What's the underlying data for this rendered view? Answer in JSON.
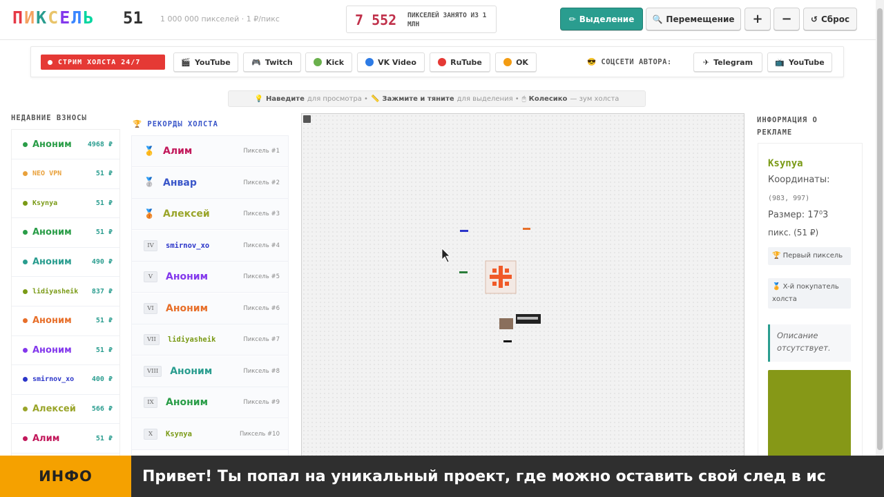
{
  "header": {
    "logo_letters": [
      "П",
      "И",
      "К",
      "С",
      "Е",
      "Л",
      "Ь"
    ],
    "logo_colors": [
      "#e63946",
      "#f4a261",
      "#2a9d8f",
      "#e9c46a",
      "#8338ec",
      "#3a86ff",
      "#06d6a0"
    ],
    "logo_number": "51",
    "subtitle": "1 000 000 пикселей · 1 ₽/пикс",
    "counter_value": "7 552",
    "counter_label": "ПИКСЕЛЕЙ ЗАНЯТО ИЗ 1 МЛН",
    "tools": {
      "select_label": "Выделение",
      "move_label": "Перемещение",
      "zoom_in": "+",
      "zoom_out": "−",
      "reset_label": "Сброс"
    }
  },
  "streams": {
    "live_label": "СТРИМ ХОЛСТА 24/7",
    "buttons": [
      {
        "label": "YouTube",
        "icon": "🎬"
      },
      {
        "label": "Twitch",
        "icon": "🎮"
      },
      {
        "label": "Kick",
        "color": "#6ab04c"
      },
      {
        "label": "VK Video",
        "color": "#2d7be5"
      },
      {
        "label": "RuTube",
        "color": "#e53935"
      },
      {
        "label": "OK",
        "color": "#f39c12"
      }
    ],
    "author_label": "СОЦСЕТИ АВТОРА:",
    "author_buttons": [
      {
        "label": "Telegram",
        "icon": "✈"
      },
      {
        "label": "YouTube",
        "icon": "📺"
      }
    ]
  },
  "hint": {
    "part1_bold": "Наведите",
    "part1": "для просмотра •",
    "part2_bold": "Зажмите и тяните",
    "part2": "для выделения •",
    "part3_bold": "Колесико",
    "part3": "— зум холста"
  },
  "recent": {
    "title": "НЕДАВНИЕ ВЗНОСЫ",
    "items": [
      {
        "name": "Аноним",
        "amount": "4968 ₽",
        "color": "#2a9d48",
        "small": false
      },
      {
        "name": "NEO VPN",
        "amount": "51 ₽",
        "color": "#e9a13b",
        "small": true
      },
      {
        "name": "Ksynya",
        "amount": "51 ₽",
        "color": "#7a9a16",
        "small": true
      },
      {
        "name": "Аноним",
        "amount": "51 ₽",
        "color": "#2a9d48",
        "small": false
      },
      {
        "name": "Аноним",
        "amount": "490 ₽",
        "color": "#2a9d8f",
        "small": false
      },
      {
        "name": "lidiyasheik",
        "amount": "837 ₽",
        "color": "#7a9a16",
        "small": true
      },
      {
        "name": "Аноним",
        "amount": "51 ₽",
        "color": "#e76f2a",
        "small": false
      },
      {
        "name": "Аноним",
        "amount": "51 ₽",
        "color": "#8338ec",
        "small": false
      },
      {
        "name": "smirnov_xo",
        "amount": "400 ₽",
        "color": "#2b35c9",
        "small": true
      },
      {
        "name": "Алексей",
        "amount": "566 ₽",
        "color": "#9aa52a",
        "small": false
      },
      {
        "name": "Алим",
        "amount": "51 ₽",
        "color": "#c2185b",
        "small": false
      }
    ]
  },
  "records": {
    "title": "РЕКОРДЫ ХОЛСТА",
    "items": [
      {
        "rank": "🥇",
        "name": "Алим",
        "pixel": "Пиксель #1",
        "color": "#c2185b",
        "mono": false,
        "medal": true
      },
      {
        "rank": "🥈",
        "name": "Анвар",
        "pixel": "Пиксель #2",
        "color": "#3a56c9",
        "mono": false,
        "medal": true
      },
      {
        "rank": "🥉",
        "name": "Алексей",
        "pixel": "Пиксель #3",
        "color": "#9aa52a",
        "mono": false,
        "medal": true
      },
      {
        "rank": "IV",
        "name": "smirnov_xo",
        "pixel": "Пиксель #4",
        "color": "#2b35c9",
        "mono": true,
        "medal": false
      },
      {
        "rank": "V",
        "name": "Аноним",
        "pixel": "Пиксель #5",
        "color": "#8338ec",
        "mono": false,
        "medal": false
      },
      {
        "rank": "VI",
        "name": "Аноним",
        "pixel": "Пиксель #6",
        "color": "#e76f2a",
        "mono": false,
        "medal": false
      },
      {
        "rank": "VII",
        "name": "lidiyasheik",
        "pixel": "Пиксель #7",
        "color": "#7a9a16",
        "mono": true,
        "medal": false
      },
      {
        "rank": "VIII",
        "name": "Аноним",
        "pixel": "Пиксель #8",
        "color": "#2a9d8f",
        "mono": false,
        "medal": false
      },
      {
        "rank": "IX",
        "name": "Аноним",
        "pixel": "Пиксель #9",
        "color": "#2a9d48",
        "mono": false,
        "medal": false
      },
      {
        "rank": "X",
        "name": "Ksynya",
        "pixel": "Пиксель #10",
        "color": "#7a9a16",
        "mono": true,
        "medal": false
      }
    ]
  },
  "ad": {
    "title": "ИНФОРМАЦИЯ О РЕКЛАМЕ",
    "name": "Ksynya",
    "coords_label": "Координаты:",
    "coords_value": "(983, 997)",
    "size_label": "Размер: 17⁰3",
    "size_value": "пикс. (51 ₽)",
    "badge1": "🏆 Первый пиксель",
    "badge2": "🏅 X-й покупатель холста",
    "description": "Описание отсутствует.",
    "swatch_color": "#869817"
  },
  "ticker": {
    "label": "ИНФО",
    "text": "Привет! Ты попал на уникальный проект, где можно оставить свой след в ис"
  }
}
